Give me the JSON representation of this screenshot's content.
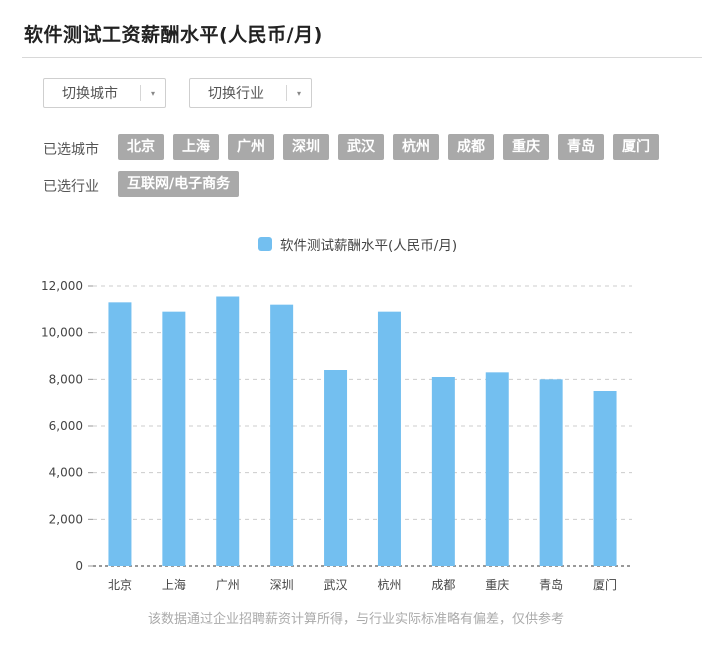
{
  "page": {
    "title": "软件测试工资薪酬水平(人民币/月)"
  },
  "controls": {
    "switch_city_label": "切换城市",
    "switch_industry_label": "切换行业",
    "dropdown_arrow": "▾"
  },
  "filters": {
    "cities_label": "已选城市",
    "selected_cities": [
      "北京",
      "上海",
      "广州",
      "深圳",
      "武汉",
      "杭州",
      "成都",
      "重庆",
      "青岛",
      "厦门"
    ],
    "industry_label": "已选行业",
    "selected_industries": [
      "互联网/电子商务"
    ]
  },
  "chart_data": {
    "type": "bar",
    "title": "",
    "categories": [
      "北京",
      "上海",
      "广州",
      "深圳",
      "武汉",
      "杭州",
      "成都",
      "重庆",
      "青岛",
      "厦门"
    ],
    "series": [
      {
        "name": "软件测试薪酬水平(人民币/月)",
        "color": "#73bff0",
        "values": [
          11300,
          10900,
          11550,
          11200,
          8400,
          10900,
          8100,
          8300,
          8000,
          7500
        ]
      }
    ],
    "ylim": [
      0,
      12000
    ],
    "yticks": [
      0,
      2000,
      4000,
      6000,
      8000,
      10000,
      12000
    ],
    "ytick_labels": [
      "0",
      "2,000",
      "4,000",
      "6,000",
      "8,000",
      "10,000",
      "12,000"
    ],
    "xlabel": "",
    "ylabel": "",
    "grid": true,
    "legend_position": "top-center"
  },
  "footer": {
    "note": "该数据通过企业招聘薪资计算所得，与行业实际标准略有偏差，仅供参考"
  }
}
